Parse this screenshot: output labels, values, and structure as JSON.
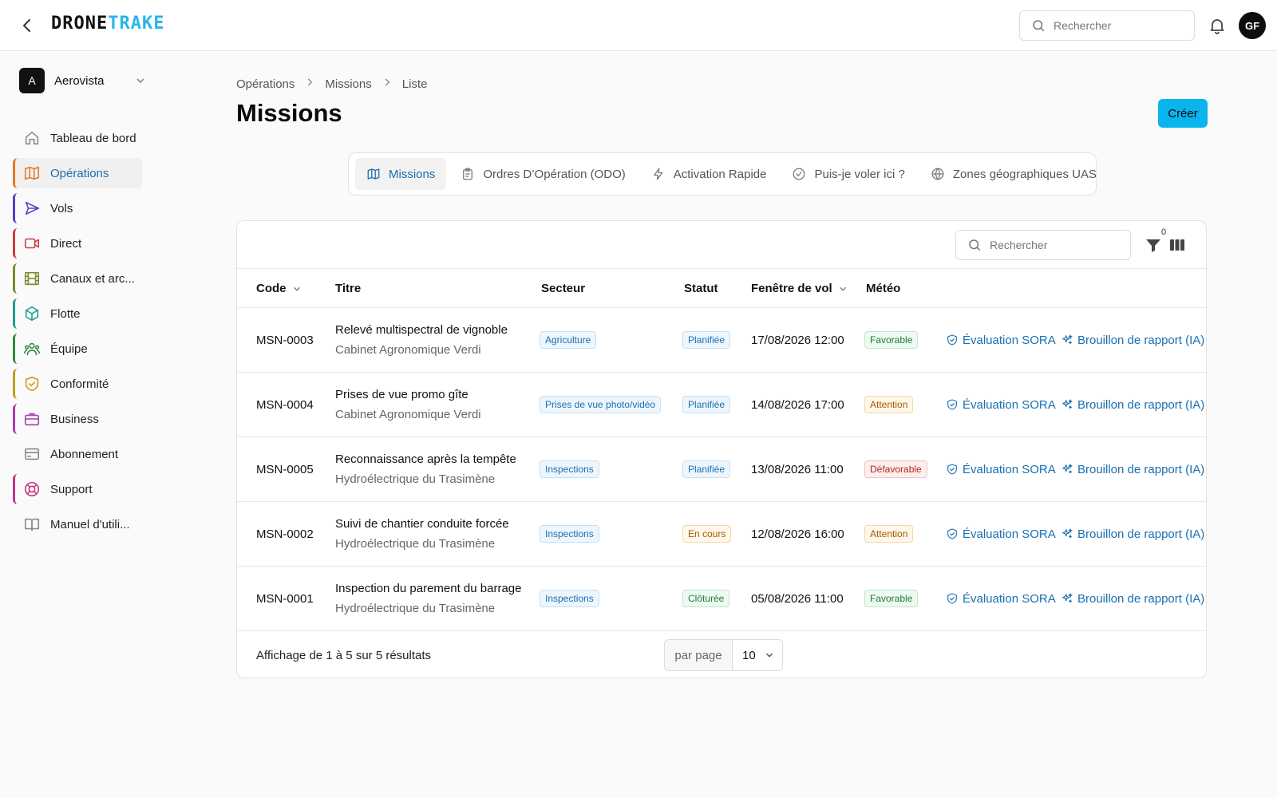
{
  "app": {
    "logo_part1": "DRONE",
    "logo_part2": "TRAKE",
    "search_placeholder": "Rechercher",
    "user_initials": "GF",
    "accent_color": "#0ab4ec",
    "link_color": "#1a6fb0"
  },
  "sidebar": {
    "org_initial": "A",
    "org_name": "Aerovista",
    "items": [
      {
        "label": "Tableau de bord",
        "icon": "home-icon",
        "color": "#888888",
        "active": false
      },
      {
        "label": "Opérations",
        "icon": "map-icon",
        "color": "#e07a2a",
        "active": true
      },
      {
        "label": "Vols",
        "icon": "send-icon",
        "color": "#5b3fc4",
        "active": false
      },
      {
        "label": "Direct",
        "icon": "video-icon",
        "color": "#d23a3a",
        "active": false
      },
      {
        "label": "Canaux et arc...",
        "icon": "film-icon",
        "color": "#7a8a2a",
        "active": false
      },
      {
        "label": "Flotte",
        "icon": "box-icon",
        "color": "#1f9a8a",
        "active": false
      },
      {
        "label": "Équipe",
        "icon": "users-icon",
        "color": "#2e8b3e",
        "active": false
      },
      {
        "label": "Conformité",
        "icon": "shield-icon",
        "color": "#c79a1a",
        "active": false
      },
      {
        "label": "Business",
        "icon": "briefcase-icon",
        "color": "#b03ab0",
        "active": false
      },
      {
        "label": "Abonnement",
        "icon": "credit-card-icon",
        "color": "#888888",
        "active": false
      },
      {
        "label": "Support",
        "icon": "lifebuoy-icon",
        "color": "#c0358a",
        "active": false
      },
      {
        "label": "Manuel d'utili...",
        "icon": "book-icon",
        "color": "#888888",
        "active": false
      }
    ]
  },
  "breadcrumb": [
    "Opérations",
    "Missions",
    "Liste"
  ],
  "page": {
    "title": "Missions",
    "create_label": "Créer"
  },
  "tabs": [
    {
      "label": "Missions",
      "icon": "map-icon",
      "active": true
    },
    {
      "label": "Ordres D’Opération (ODO)",
      "icon": "clipboard-icon",
      "active": false
    },
    {
      "label": "Activation Rapide",
      "icon": "zap-icon",
      "active": false
    },
    {
      "label": "Puis-je voler ici ?",
      "icon": "check-circle-icon",
      "active": false
    },
    {
      "label": "Zones géographiques UAS",
      "icon": "globe-icon",
      "active": false
    }
  ],
  "table": {
    "search_placeholder": "Rechercher",
    "filter_count": "0",
    "columns": [
      "Code",
      "Titre",
      "Secteur",
      "Statut",
      "Fenêtre de vol",
      "Météo"
    ],
    "action_sora": "Évaluation SORA",
    "action_report": "Brouillon de rapport (IA)",
    "rows": [
      {
        "code": "MSN-0003",
        "title": "Relevé multispectral de vignoble",
        "client": "Cabinet Agronomique Verdi",
        "sector": "Agriculture",
        "status": "Planifiée",
        "status_tone": "blue",
        "window": "17/08/2026 12:00",
        "weather": "Favorable",
        "weather_tone": "green"
      },
      {
        "code": "MSN-0004",
        "title": "Prises de vue promo gîte",
        "client": "Cabinet Agronomique Verdi",
        "sector": "Prises de vue photo/vidéo",
        "status": "Planifiée",
        "status_tone": "blue",
        "window": "14/08/2026 17:00",
        "weather": "Attention",
        "weather_tone": "amber"
      },
      {
        "code": "MSN-0005",
        "title": "Reconnaissance après la tempête",
        "client": "Hydroélectrique du Trasimène",
        "sector": "Inspections",
        "status": "Planifiée",
        "status_tone": "blue",
        "window": "13/08/2026 11:00",
        "weather": "Défavorable",
        "weather_tone": "red"
      },
      {
        "code": "MSN-0002",
        "title": "Suivi de chantier conduite forcée",
        "client": "Hydroélectrique du Trasimène",
        "sector": "Inspections",
        "status": "En cours",
        "status_tone": "amber",
        "window": "12/08/2026 16:00",
        "weather": "Attention",
        "weather_tone": "amber"
      },
      {
        "code": "MSN-0001",
        "title": "Inspection du parement du barrage",
        "client": "Hydroélectrique du Trasimène",
        "sector": "Inspections",
        "status": "Clôturée",
        "status_tone": "green",
        "window": "05/08/2026 11:00",
        "weather": "Favorable",
        "weather_tone": "green"
      }
    ]
  },
  "footer": {
    "results_text": "Affichage de 1 à 5 sur 5 résultats",
    "per_page_label": "par page",
    "per_page_value": "10"
  }
}
